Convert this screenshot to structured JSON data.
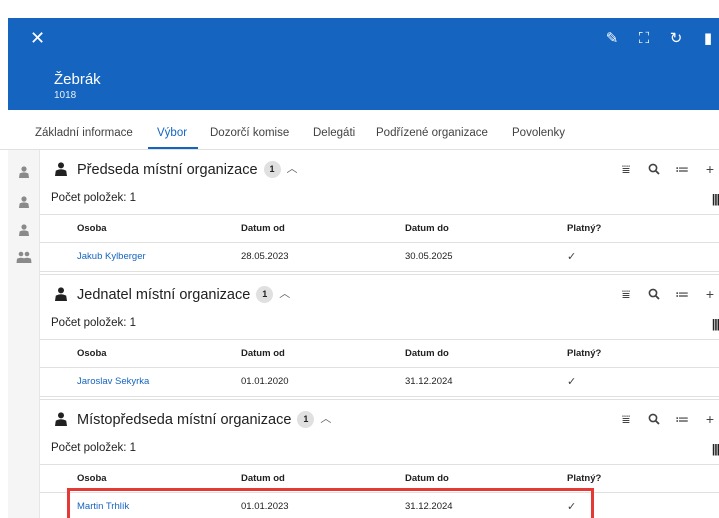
{
  "header": {
    "close_icon": "close-icon",
    "title": "Žebrák",
    "subtitle": "1018",
    "actions": [
      {
        "name": "edit-icon",
        "glyph": "✎"
      },
      {
        "name": "fullscreen-icon",
        "glyph": "⛶"
      },
      {
        "name": "refresh-icon",
        "glyph": "↻"
      },
      {
        "name": "delete-icon",
        "glyph": "▮"
      }
    ],
    "color": "#1565c0"
  },
  "tabs": [
    {
      "label": "Základní informace",
      "active": false
    },
    {
      "label": "Výbor",
      "active": true
    },
    {
      "label": "Dozorčí komise",
      "active": false
    },
    {
      "label": "Delegáti",
      "active": false
    },
    {
      "label": "Podřízené organizace",
      "active": false
    },
    {
      "label": "Povolenky",
      "active": false
    }
  ],
  "left_rail": [
    "person-icon",
    "person-icon",
    "person-icon",
    "people-icon"
  ],
  "columns": {
    "osoba": "Osoba",
    "datum_od": "Datum od",
    "datum_do": "Datum do",
    "platny": "Platný?"
  },
  "sections": [
    {
      "title": "Předseda místní organizace",
      "badge": "1",
      "count_label": "Počet položek: 1",
      "rows": [
        {
          "osoba": "Jakub Kylberger",
          "datum_od": "28.05.2023",
          "datum_do": "30.05.2025",
          "platny": "✓"
        }
      ]
    },
    {
      "title": "Jednatel místní organizace",
      "badge": "1",
      "count_label": "Počet položek: 1",
      "rows": [
        {
          "osoba": "Jaroslav Sekyrka",
          "datum_od": "01.01.2020",
          "datum_do": "31.12.2024",
          "platny": "✓"
        }
      ]
    },
    {
      "title": "Místopředseda místní organizace",
      "badge": "1",
      "count_label": "Počet položek: 1",
      "rows": [
        {
          "osoba": "Martin Trhlík",
          "datum_od": "01.01.2023",
          "datum_do": "31.12.2024",
          "platny": "✓"
        }
      ]
    }
  ],
  "highlight_color": "#e53935"
}
